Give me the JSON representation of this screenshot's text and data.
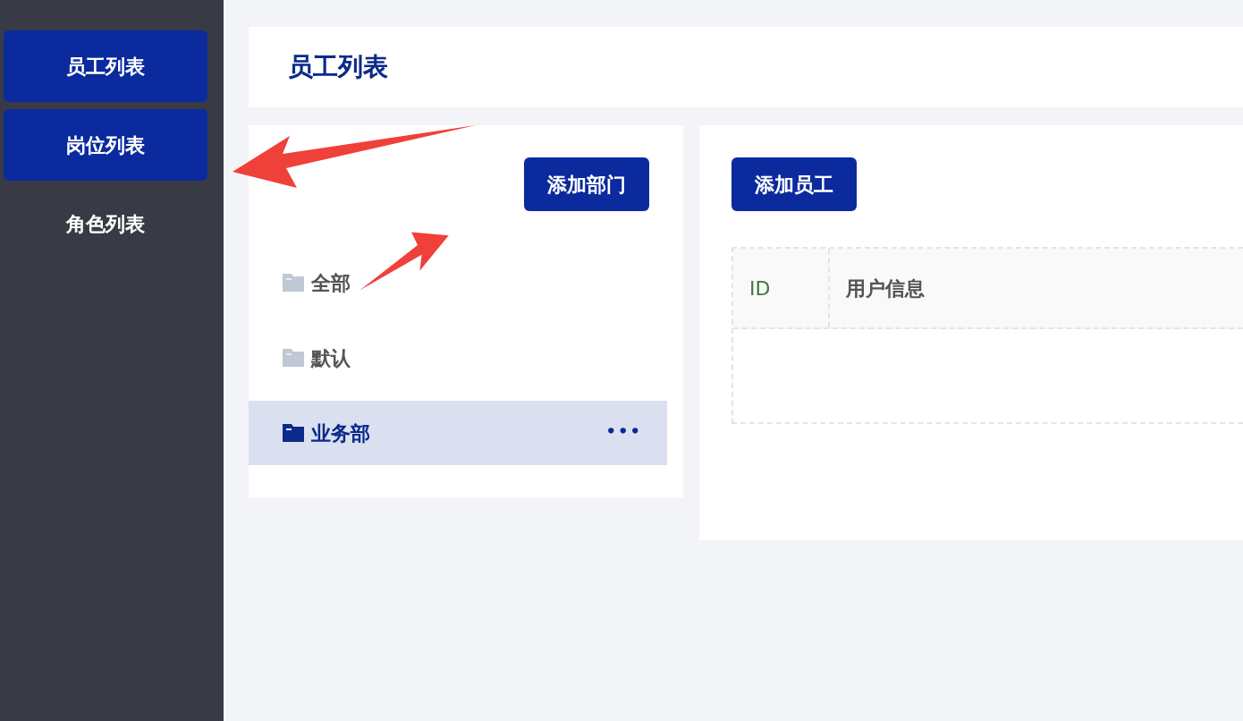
{
  "sidebar": {
    "items": [
      {
        "label": "员工列表",
        "selected": true
      },
      {
        "label": "岗位列表",
        "selected": true
      },
      {
        "label": "角色列表",
        "selected": false
      }
    ]
  },
  "header": {
    "title": "员工列表"
  },
  "departments": {
    "add_button": "添加部门",
    "items": [
      {
        "label": "全部",
        "selected": false
      },
      {
        "label": "默认",
        "selected": false
      },
      {
        "label": "业务部",
        "selected": true,
        "more": "•••"
      }
    ]
  },
  "employees": {
    "add_button": "添加员工",
    "table": {
      "columns": [
        "ID",
        "用户信息"
      ]
    }
  }
}
